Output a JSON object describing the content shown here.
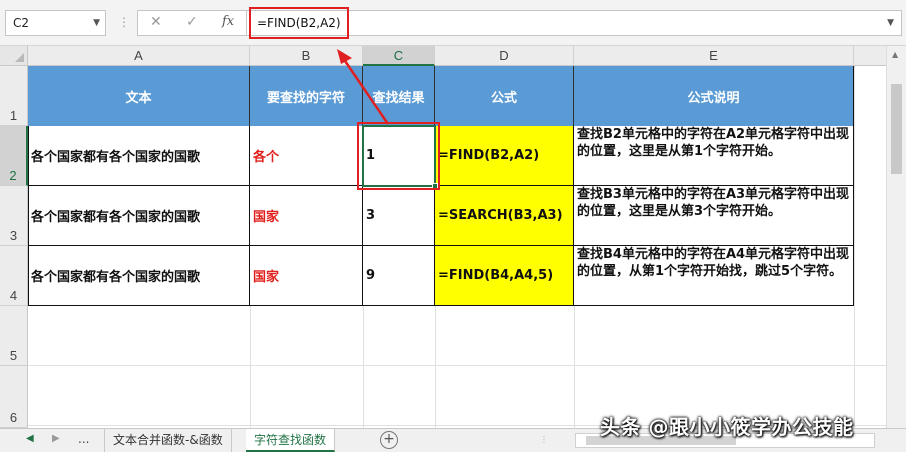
{
  "formula_bar": {
    "name_box": "C2",
    "formula": "=FIND(B2,A2)",
    "cancel_icon": "close-icon",
    "enter_icon": "check-icon",
    "fx_label": "fx"
  },
  "columns": [
    "A",
    "B",
    "C",
    "D",
    "E"
  ],
  "rows": [
    "1",
    "2",
    "3",
    "4",
    "5",
    "6"
  ],
  "header_row": {
    "a": "文本",
    "b": "要查找的字符",
    "c": "查找结果",
    "d": "公式",
    "e": "公式说明"
  },
  "data_rows": [
    {
      "text": "各个国家都有各个国家的国歌",
      "find": "各个",
      "result": "1",
      "formula": "=FIND(B2,A2)",
      "explain": "查找B2单元格中的字符在A2单元格字符中出现的位置，这里是从第1个字符开始。"
    },
    {
      "text": "各个国家都有各个国家的国歌",
      "find": "国家",
      "result": "3",
      "formula": "=SEARCH(B3,A3)",
      "explain": "查找B3单元格中的字符在A3单元格字符中出现的位置，这里是从第3个字符开始。"
    },
    {
      "text": "各个国家都有各个国家的国歌",
      "find": "国家",
      "result": "9",
      "formula": "=FIND(B4,A4,5)",
      "explain": "查找B4单元格中的字符在A4单元格字符中出现的位置，从第1个字符开始找，跳过5个字符。"
    }
  ],
  "tabs": {
    "more": "...",
    "sheet1": "文本合并函数-&函数",
    "sheet2": "字符查找函数"
  },
  "watermark": "头条 @跟小小筱学办公技能",
  "colors": {
    "header_fill": "#5b9bd5",
    "formula_fill": "#ffff00",
    "highlight_text": "#e0201c",
    "annotation": "#e02020",
    "selection": "#217346"
  }
}
